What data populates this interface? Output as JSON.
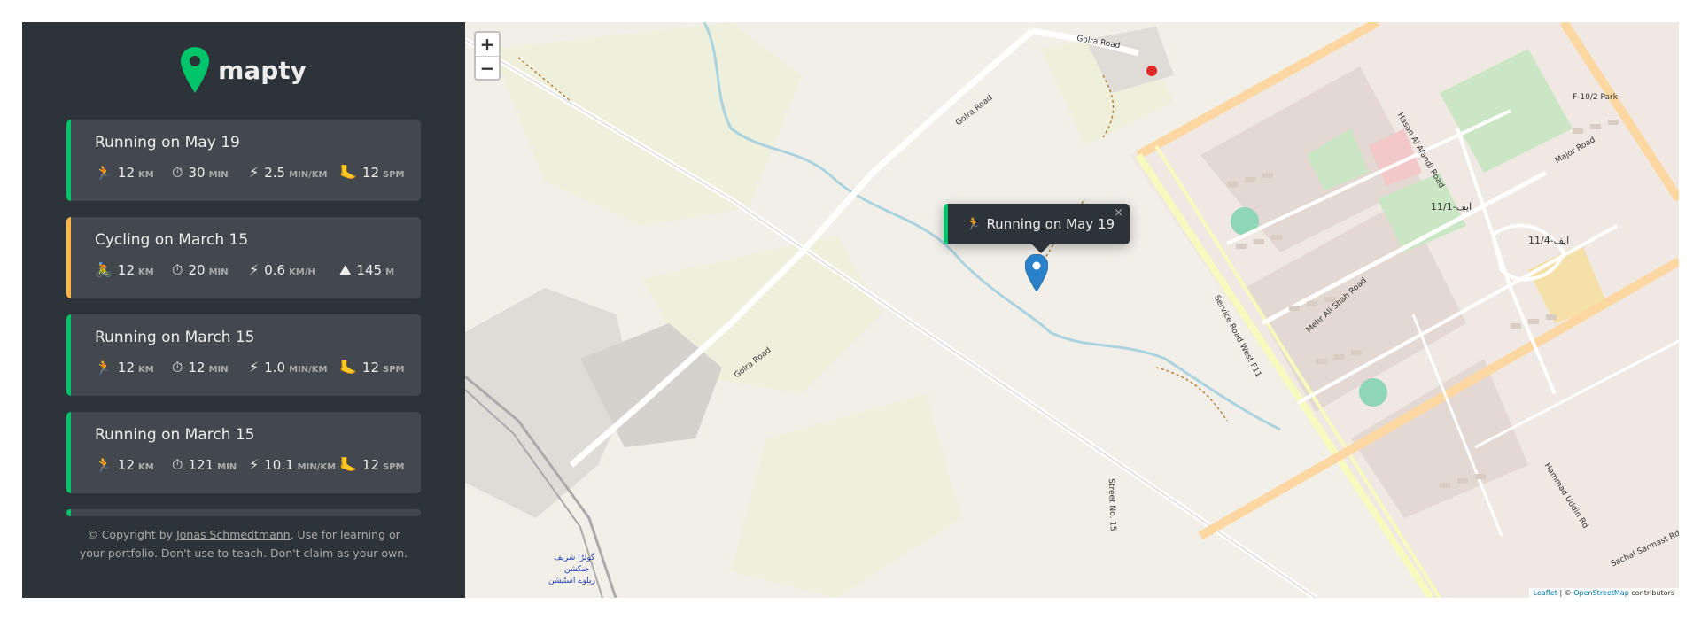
{
  "logo": {
    "text": "mapty"
  },
  "workouts": [
    {
      "type": "running",
      "title": "Running on May 19",
      "stats": [
        {
          "icon": "🏃",
          "value": "12",
          "unit": "KM"
        },
        {
          "icon": "⏱",
          "value": "30",
          "unit": "MIN"
        },
        {
          "icon": "⚡",
          "value": "2.5",
          "unit": "MIN/KM"
        },
        {
          "icon": "🦶",
          "value": "12",
          "unit": "SPM"
        }
      ]
    },
    {
      "type": "cycling",
      "title": "Cycling on March 15",
      "stats": [
        {
          "icon": "🚴",
          "value": "12",
          "unit": "KM"
        },
        {
          "icon": "⏱",
          "value": "20",
          "unit": "MIN"
        },
        {
          "icon": "⚡",
          "value": "0.6",
          "unit": "KM/H"
        },
        {
          "icon": "⛰",
          "value": "145",
          "unit": "M"
        }
      ]
    },
    {
      "type": "running",
      "title": "Running on March 15",
      "stats": [
        {
          "icon": "🏃",
          "value": "12",
          "unit": "KM"
        },
        {
          "icon": "⏱",
          "value": "12",
          "unit": "MIN"
        },
        {
          "icon": "⚡",
          "value": "1.0",
          "unit": "MIN/KM"
        },
        {
          "icon": "🦶",
          "value": "12",
          "unit": "SPM"
        }
      ]
    },
    {
      "type": "running",
      "title": "Running on March 15",
      "stats": [
        {
          "icon": "🏃",
          "value": "12",
          "unit": "KM"
        },
        {
          "icon": "⏱",
          "value": "121",
          "unit": "MIN"
        },
        {
          "icon": "⚡",
          "value": "10.1",
          "unit": "MIN/KM"
        },
        {
          "icon": "🦶",
          "value": "12",
          "unit": "SPM"
        }
      ]
    }
  ],
  "copyright": {
    "prefix": "© Copyright by ",
    "author": "Jonas Schmedtmann",
    "suffix": ". Use for learning or your portfolio. Don't use to teach. Don't claim as your own."
  },
  "map": {
    "zoom_in": "+",
    "zoom_out": "−",
    "popup": {
      "icon": "🏃",
      "text": "Running on May 19",
      "close": "×"
    },
    "attribution": {
      "leaflet": "Leaflet",
      "separator": " | © ",
      "osm": "OpenStreetMap",
      "contributors": " contributors"
    },
    "labels": {
      "golra_road_top": "Golra Road",
      "golra_road_mid": "Golra Road",
      "golra_road_low": "Golra Road",
      "service_road_west": "Service Road West F11",
      "major_road": "Major Road",
      "street_15": "Street No. 15",
      "mehr_ali_shah": "Mehr Ali Shah Road",
      "hasan_al_afandi": "Hasan Al Afandi Road",
      "f11_1": "ایف-11/1",
      "f11_4": "11/4-ایف",
      "f10_2_park": "F-10/2 Park",
      "station_1": "گولڑا شریف",
      "station_2": "جنکشن",
      "station_3": "ریلوے اسٹیشن",
      "sachal": "Sachal Sarmast Rd",
      "hammad": "Hammad Uddin Rd"
    }
  },
  "colors": {
    "sidebar_bg": "#2d3439",
    "card_bg": "#42484d",
    "running": "#00c46a",
    "cycling": "#ffb545",
    "marker": "#2a81cb"
  }
}
